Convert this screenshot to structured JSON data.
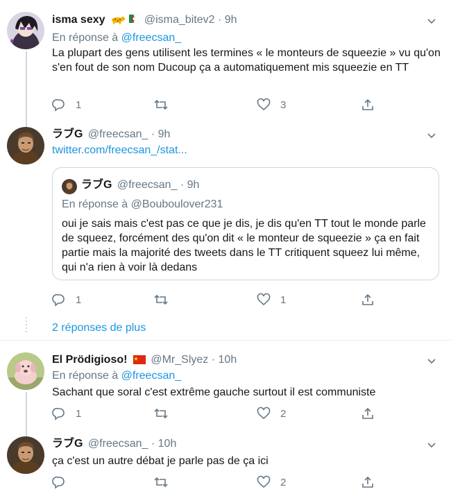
{
  "tweets": [
    {
      "name": "isma sexy",
      "handle": "@isma_bitev2",
      "time": "9h",
      "reply_prefix": "En réponse à",
      "reply_to": "@freecsan_",
      "text": "La plupart des gens utilisent les termines « le monteurs de squeezie » vu qu'on s'en fout de son nom Ducoup ça a automatiquement mis squeezie en TT",
      "replies": "1",
      "retweets": "",
      "likes": "3"
    },
    {
      "name": "ラブG",
      "handle": "@freecsan_",
      "time": "9h",
      "link": "twitter.com/freecsan_/stat...",
      "quote": {
        "name": "ラブG",
        "handle": "@freecsan_",
        "time": "9h",
        "reply_prefix": "En réponse à",
        "reply_to": "@Bouboulover231",
        "text": "oui je sais mais c'est pas ce que je dis, je dis qu'en TT tout le monde parle de squeez, forcément des qu'on dit « le monteur de squeezie » ça en fait partie mais la majorité des tweets dans le TT critiquent squeez lui même, qui n'a rien à voir là dedans"
      },
      "replies": "1",
      "retweets": "",
      "likes": "1"
    },
    {
      "name": "El Prödigioso!",
      "handle": "@Mr_Slyez",
      "time": "10h",
      "reply_prefix": "En réponse à",
      "reply_to": "@freecsan_",
      "text": "Sachant que soral c'est extrême gauche surtout il est communiste",
      "replies": "1",
      "retweets": "",
      "likes": "2"
    },
    {
      "name": "ラブG",
      "handle": "@freecsan_",
      "time": "10h",
      "text": "ça c'est un autre débat je parle pas de ça ici",
      "replies": "",
      "retweets": "",
      "likes": "2"
    }
  ],
  "more_replies": "2 réponses de plus",
  "separator_dot": "·",
  "colors": {
    "accent": "#1b95e0",
    "secondary_text": "#657786",
    "border": "#e6ecf0"
  }
}
